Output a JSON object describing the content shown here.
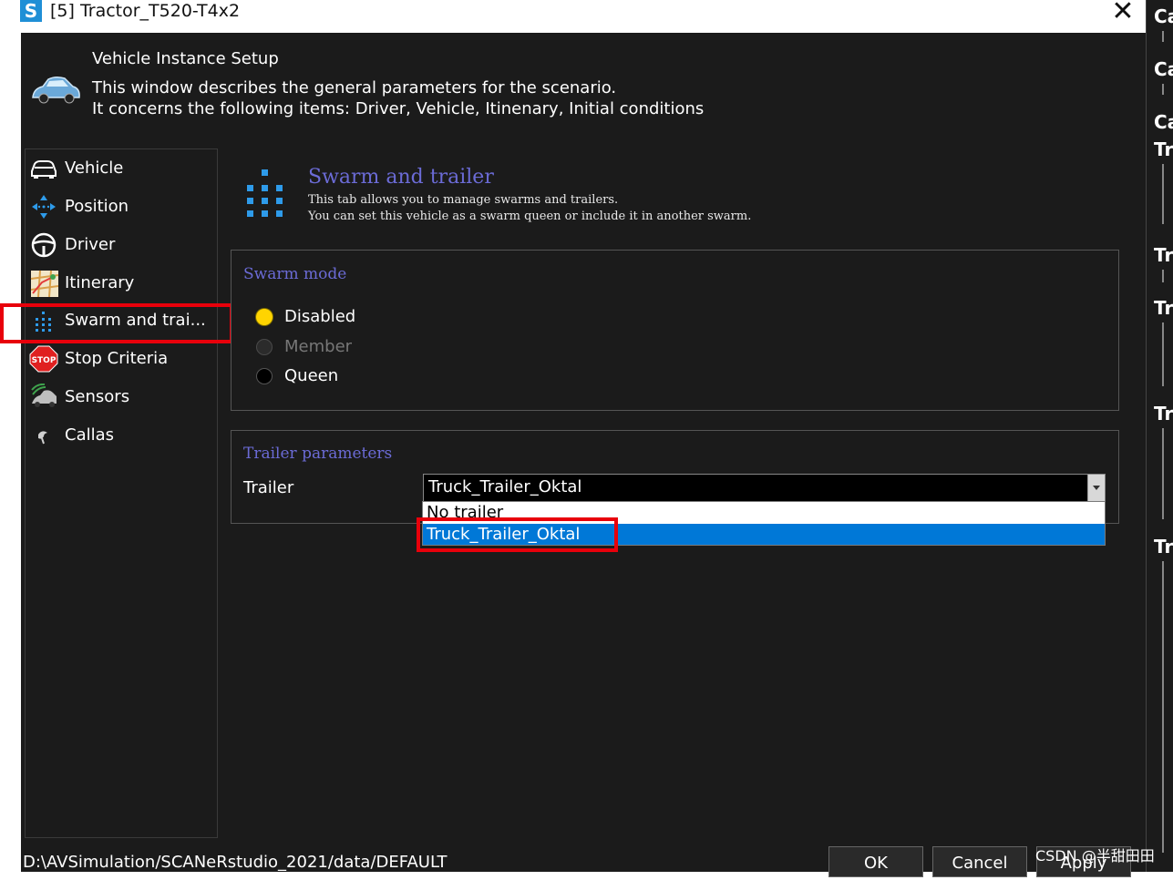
{
  "window": {
    "title": "[5] Tractor_T520-T4x2",
    "close_glyph": "✕"
  },
  "header": {
    "title": "Vehicle Instance Setup",
    "desc1": "This window describes the general parameters for the scenario.",
    "desc2": "It concerns the following items: Driver, Vehicle, Itinenary, Initial conditions"
  },
  "sidebar": {
    "items": [
      {
        "label": "Vehicle",
        "icon": "car-icon"
      },
      {
        "label": "Position",
        "icon": "move-arrows-icon"
      },
      {
        "label": "Driver",
        "icon": "steering-wheel-icon"
      },
      {
        "label": "Itinerary",
        "icon": "map-icon"
      },
      {
        "label": "Swarm and trai...",
        "icon": "swarm-dots-icon",
        "selected": true
      },
      {
        "label": "Stop Criteria",
        "icon": "stop-sign-icon"
      },
      {
        "label": "Sensors",
        "icon": "sensor-icon"
      },
      {
        "label": "Callas",
        "icon": "callas-icon"
      }
    ]
  },
  "section": {
    "title": "Swarm and trailer",
    "desc1": "This tab allows you to manage swarms and trailers.",
    "desc2": "You can set this vehicle as a swarm queen or include it in another swarm."
  },
  "swarm_mode": {
    "title": "Swarm mode",
    "options": [
      {
        "label": "Disabled",
        "state": "selected"
      },
      {
        "label": "Member",
        "state": "disabled"
      },
      {
        "label": "Queen",
        "state": "unselected"
      }
    ]
  },
  "trailer": {
    "title": "Trailer parameters",
    "label": "Trailer",
    "value": "Truck_Trailer_Oktal",
    "options": [
      {
        "label": "No trailer",
        "highlighted": false
      },
      {
        "label": "Truck_Trailer_Oktal",
        "highlighted": true
      }
    ]
  },
  "footer": {
    "path": "D:\\AVSimulation/SCANeRstudio_2021/data/DEFAULT",
    "ok": "OK",
    "cancel": "Cancel",
    "apply": "Apply"
  },
  "right_strip": {
    "labels": [
      "Ca",
      "Ca",
      "Ca",
      "Tr",
      "Tr",
      "Tr",
      "Tr",
      "Tr"
    ]
  },
  "watermark": "CSDN @半甜田田",
  "colors": {
    "background": "#1b1b1b",
    "accent_title": "#6b6bd6",
    "selection": "#0078d7",
    "radio_selected": "#ffd400",
    "annotation": "#e8000b"
  }
}
